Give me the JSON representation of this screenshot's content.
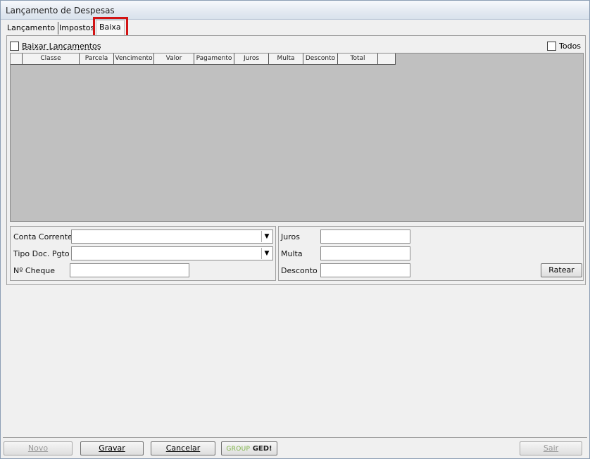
{
  "window": {
    "title": "Lançamento de Despesas"
  },
  "tabs": [
    {
      "label": "Lançamento",
      "active": false
    },
    {
      "label": "Impostos",
      "active": false
    },
    {
      "label": "Baixa",
      "active": true
    }
  ],
  "baixa": {
    "baixar_label": "Baixar Lançamentos",
    "todos_label": "Todos",
    "grid_columns": [
      "Classe",
      "Parcela",
      "Vencimento",
      "Valor",
      "Pagamento",
      "Juros",
      "Multa",
      "Desconto",
      "Total"
    ],
    "left_fields": {
      "conta_corrente_label": "Conta Corrente",
      "conta_corrente_value": "",
      "tipo_doc_label": "Tipo Doc. Pgto",
      "tipo_doc_value": "",
      "cheque_label": "Nº Cheque",
      "cheque_value": ""
    },
    "right_fields": {
      "juros_label": "Juros",
      "juros_value": "",
      "multa_label": "Multa",
      "multa_value": "",
      "desconto_label": "Desconto",
      "desconto_value": "",
      "ratear_label": "Ratear"
    }
  },
  "footer": {
    "novo_label": "Novo",
    "gravar_label": "Gravar",
    "cancelar_label": "Cancelar",
    "logo_part1": "GROUP",
    "logo_part2": "GED!",
    "sair_label": "Sair"
  },
  "colors": {
    "highlight": "#d21414",
    "grid_background": "#c0c0c0",
    "logo_green": "#7cb342"
  }
}
